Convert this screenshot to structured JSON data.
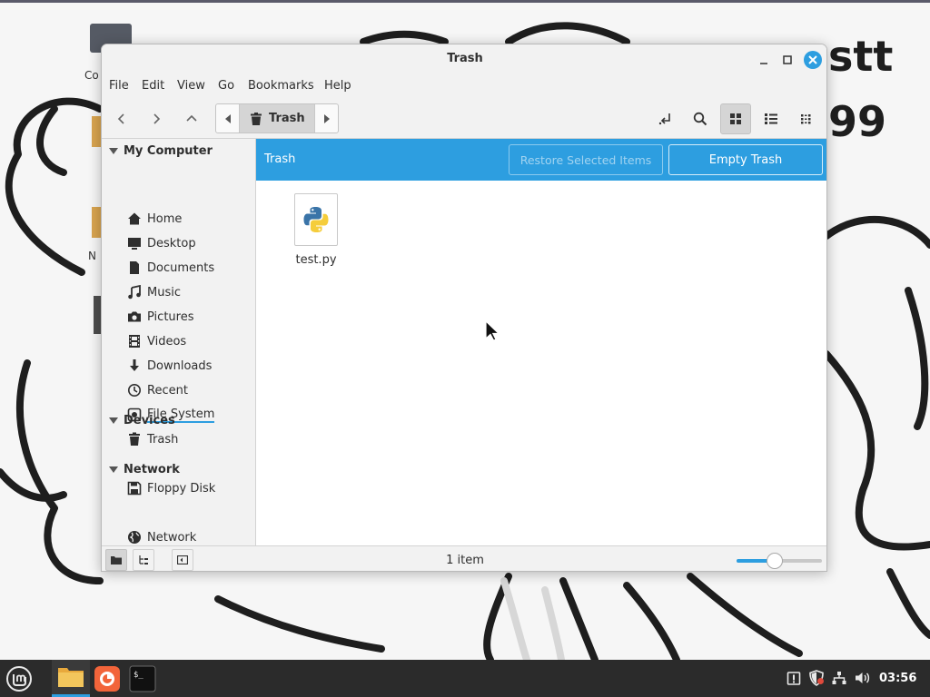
{
  "window": {
    "title": "Trash"
  },
  "menu": [
    "File",
    "Edit",
    "View",
    "Go",
    "Bookmarks",
    "Help"
  ],
  "pathbar": {
    "current": "Trash"
  },
  "sidebar": {
    "sections": [
      {
        "title": "My Computer",
        "items": [
          "Home",
          "Desktop",
          "Documents",
          "Music",
          "Pictures",
          "Videos",
          "Downloads",
          "Recent",
          "File System",
          "Trash"
        ]
      },
      {
        "title": "Devices",
        "items": [
          "Floppy Disk"
        ]
      },
      {
        "title": "Network",
        "items": [
          "Network"
        ]
      }
    ]
  },
  "trashbar": {
    "label": "Trash",
    "restore_label": "Restore Selected Items",
    "empty_label": "Empty Trash"
  },
  "files": [
    {
      "name": "test.py",
      "icon": "python-file-icon"
    }
  ],
  "status": {
    "text": "1 item",
    "zoom_fraction": 0.45
  },
  "desktop": {
    "icons": [
      {
        "label": "Co",
        "icon": "computer-icon"
      },
      {
        "label": "N",
        "icon": "folder-icon"
      }
    ]
  },
  "taskbar": {
    "clock": "03:56",
    "apps": [
      "menu-icon",
      "files-icon",
      "firefox-icon",
      "terminal-icon"
    ]
  },
  "colors": {
    "accent": "#2d9ee0",
    "taskbar": "#2b2b2b"
  }
}
